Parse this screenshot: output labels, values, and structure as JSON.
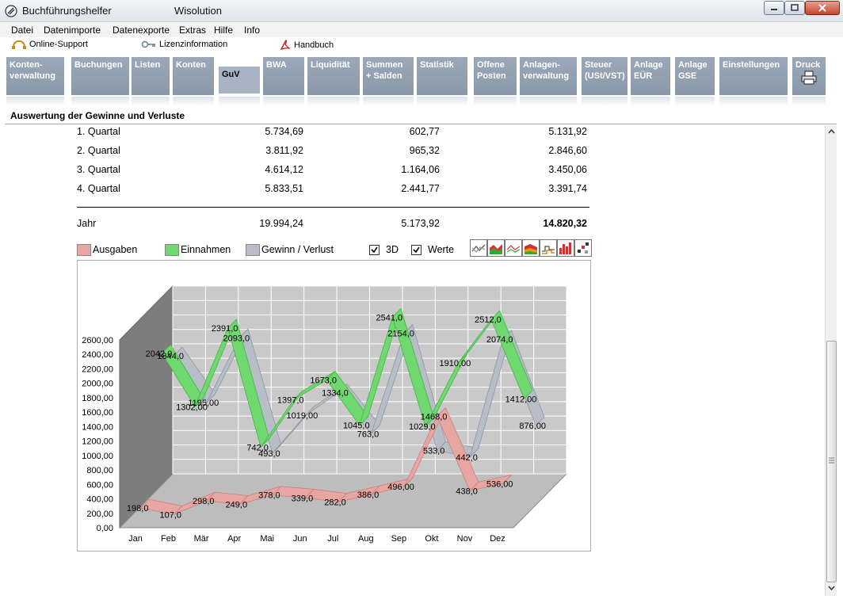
{
  "window": {
    "app_title": "Buchführungshelfer",
    "doc_title": "Wisolution"
  },
  "menu": [
    "Datei",
    "Datenimporte",
    "Datenexporte",
    "Extras",
    "Hilfe",
    "Info"
  ],
  "links": {
    "support": "Online-Support",
    "license": "Lizenzinformation",
    "manual": "Handbuch"
  },
  "tabs": [
    {
      "l1": "Konten-",
      "l2": "verwaltung"
    },
    {
      "l1": "Buchungen",
      "l2": ""
    },
    {
      "l1": "Listen",
      "l2": ""
    },
    {
      "l1": "Konten",
      "l2": ""
    },
    {
      "l1": "GuV",
      "l2": ""
    },
    {
      "l1": "BWA",
      "l2": ""
    },
    {
      "l1": "Liquidität",
      "l2": ""
    },
    {
      "l1": "Summen",
      "l2": "+ Salden"
    },
    {
      "l1": "Statistik",
      "l2": ""
    },
    {
      "l1": "Offene",
      "l2": "Posten"
    },
    {
      "l1": "Anlagen-",
      "l2": "verwaltung"
    },
    {
      "l1": "Steuer",
      "l2": "(USt/VST)"
    },
    {
      "l1": "Anlage",
      "l2": "EÜR"
    },
    {
      "l1": "Anlage",
      "l2": "GSE"
    },
    {
      "l1": "Einstellungen",
      "l2": ""
    },
    {
      "l1": "Druck",
      "l2": ""
    }
  ],
  "section_title": "Auswertung der Gewinne und Verluste",
  "quarters": [
    {
      "label": "1. Quartal",
      "a": "5.734,69",
      "b": "602,77",
      "c": "5.131,92"
    },
    {
      "label": "2. Quartal",
      "a": "3.811,92",
      "b": "965,32",
      "c": "2.846,60"
    },
    {
      "label": "3. Quartal",
      "a": "4.614,12",
      "b": "1.164,06",
      "c": "3.450,06"
    },
    {
      "label": "4. Quartal",
      "a": "5.833,51",
      "b": "2.441,77",
      "c": "3.391,74"
    }
  ],
  "year": {
    "label": "Jahr",
    "a": "19.994,24",
    "b": "5.173,92",
    "c": "14.820,32"
  },
  "legend": {
    "expenses": "Ausgaben",
    "income": "Einnahmen",
    "profit": "Gewinn / Verlust",
    "opt_3d": "3D",
    "opt_values": "Werte"
  },
  "colors": {
    "expenses": "#e8a6a3",
    "income": "#6fd86f",
    "profit": "#b7bec8",
    "tab": "#909eaf"
  },
  "chart_buttons": [
    "line-chart-icon",
    "area-chart-icon",
    "line-chart-2-icon",
    "stacked-area-icon",
    "step-chart-icon",
    "bar-chart-icon",
    "scatter-chart-icon"
  ],
  "chart_data": {
    "type": "line",
    "categories": [
      "Jan",
      "Feb",
      "Mär",
      "Apr",
      "Mai",
      "Jun",
      "Jul",
      "Aug",
      "Sep",
      "Okt",
      "Nov",
      "Dez"
    ],
    "ylim": [
      0,
      2600
    ],
    "yticks": [
      "0,00",
      "200,00",
      "400,00",
      "600,00",
      "800,00",
      "1000,00",
      "1200,00",
      "1400,00",
      "1600,00",
      "1800,00",
      "2000,00",
      "2200,00",
      "2400,00",
      "2600,00"
    ],
    "series": [
      {
        "name": "Ausgaben",
        "values": [
          198,
          107,
          298,
          249,
          378,
          339,
          282,
          386,
          496,
          1468,
          438,
          536
        ],
        "labels": [
          "198,0",
          "107,0",
          "298,0",
          "249,0",
          "378,0",
          "339,0",
          "282,0",
          "386,0",
          "496,00",
          "1468,0",
          "438,0",
          "536,00"
        ]
      },
      {
        "name": "Einnahmen",
        "values": [
          2042,
          1302,
          2391,
          742,
          1397,
          1673,
          1045,
          2541,
          1029,
          1910,
          2512,
          1412
        ],
        "labels": [
          "2042,0",
          "1302,00",
          "2391,0",
          "742,0",
          "1397,0",
          "1673,0",
          "1045,0",
          "2541,0",
          "1029,0",
          "1910,00",
          "2512,0",
          "1412,00"
        ]
      },
      {
        "name": "Gewinn / Verlust",
        "values": [
          1844,
          1195,
          2093,
          493,
          1019,
          1334,
          763,
          2154,
          533,
          442,
          2074,
          876
        ],
        "labels": [
          "1844,0",
          "1195,00",
          "2093,0",
          "493,0",
          "1019,00",
          "1334,0",
          "763,0",
          "2154,0",
          "533,0",
          "442,0",
          "2074,0",
          "876,00"
        ]
      }
    ]
  }
}
